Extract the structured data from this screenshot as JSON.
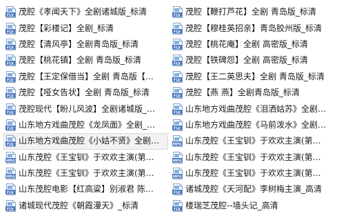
{
  "files": [
    {
      "name": "茂腔《孝闻天下》全剧诸城版_标清",
      "type": "FLV"
    },
    {
      "name": "茂腔【鞭打芦花】全剧 青岛版_标清",
      "type": "FLV"
    },
    {
      "name": "茂腔【彩楼记】全剧_标清",
      "type": "FLV"
    },
    {
      "name": "茂腔【穆桂英招亲】青岛胶州版_标清",
      "type": "FLV"
    },
    {
      "name": "茂腔【清风亭】全剧青岛版_标清",
      "type": "FLV"
    },
    {
      "name": "茂腔【桃花庵】全剧 高密版_标清",
      "type": "FLV"
    },
    {
      "name": "茂腔【桃花镇】全剧 青岛版_标清",
      "type": "FLV"
    },
    {
      "name": "茂腔【铁碑怨】全剧 高密版_标清",
      "type": "FLV"
    },
    {
      "name": "茂腔【王定保借当】全剧 青岛版【…",
      "type": "FLV"
    },
    {
      "name": "茂腔【王二英思夫】全剧 青岛版_标清",
      "type": "FLV"
    },
    {
      "name": "茂腔【哑女告状】全剧 青岛版_标清",
      "type": "FLV"
    },
    {
      "name": "茂腔【燕 燕】全剧青岛版_标清",
      "type": "FLV"
    },
    {
      "name": "茂腔现代【盼儿风波】全剧诸城版_…",
      "type": "FLV"
    },
    {
      "name": "山东地方戏曲茂腔《泪洒姑苏》全剧…",
      "type": "FLV"
    },
    {
      "name": "山东地方戏曲茂腔《龙凤面》全剧_…",
      "type": "FLV"
    },
    {
      "name": "山东地方戏曲茂腔《马前泼水》全剧…",
      "type": "FLV"
    },
    {
      "name": "山东地方戏曲茂腔《小姑不贤》全剧…",
      "type": "FLV",
      "selected": true
    },
    {
      "name": "山东茂腔《王宝钏》于欢欢主演(第…",
      "type": "MP4"
    },
    {
      "name": "山东茂腔《王宝钏》于欢欢主演(第…",
      "type": "MP4"
    },
    {
      "name": "山东茂腔《王宝钏》于欢欢主演(第…",
      "type": "MP4"
    },
    {
      "name": "山东茂腔《王宝钏》于欢欢主演(第…",
      "type": "MP4"
    },
    {
      "name": "山东茂腔《王宝钏》于欢欢主演(第…",
      "type": "MP4"
    },
    {
      "name": "山东茂腔电影【红高粱】别淑君 陈…",
      "type": "FLV"
    },
    {
      "name": "诸城茂腔《天河配》李树梅主演_高清",
      "type": "FLV"
    },
    {
      "name": "诸城现代茂腔《朝霞漫天》_标清",
      "type": "FLV"
    },
    {
      "name": "楼瑞芝茂腔--墙头记_高清",
      "type": "FLV"
    }
  ],
  "colors": {
    "flv_icon": "#3d6fb6",
    "mp4_icon": "#3d6fb6",
    "text": "#1a1a1a",
    "selection_bg": "#f2f2f2",
    "selection_border": "#d9d9d9"
  }
}
